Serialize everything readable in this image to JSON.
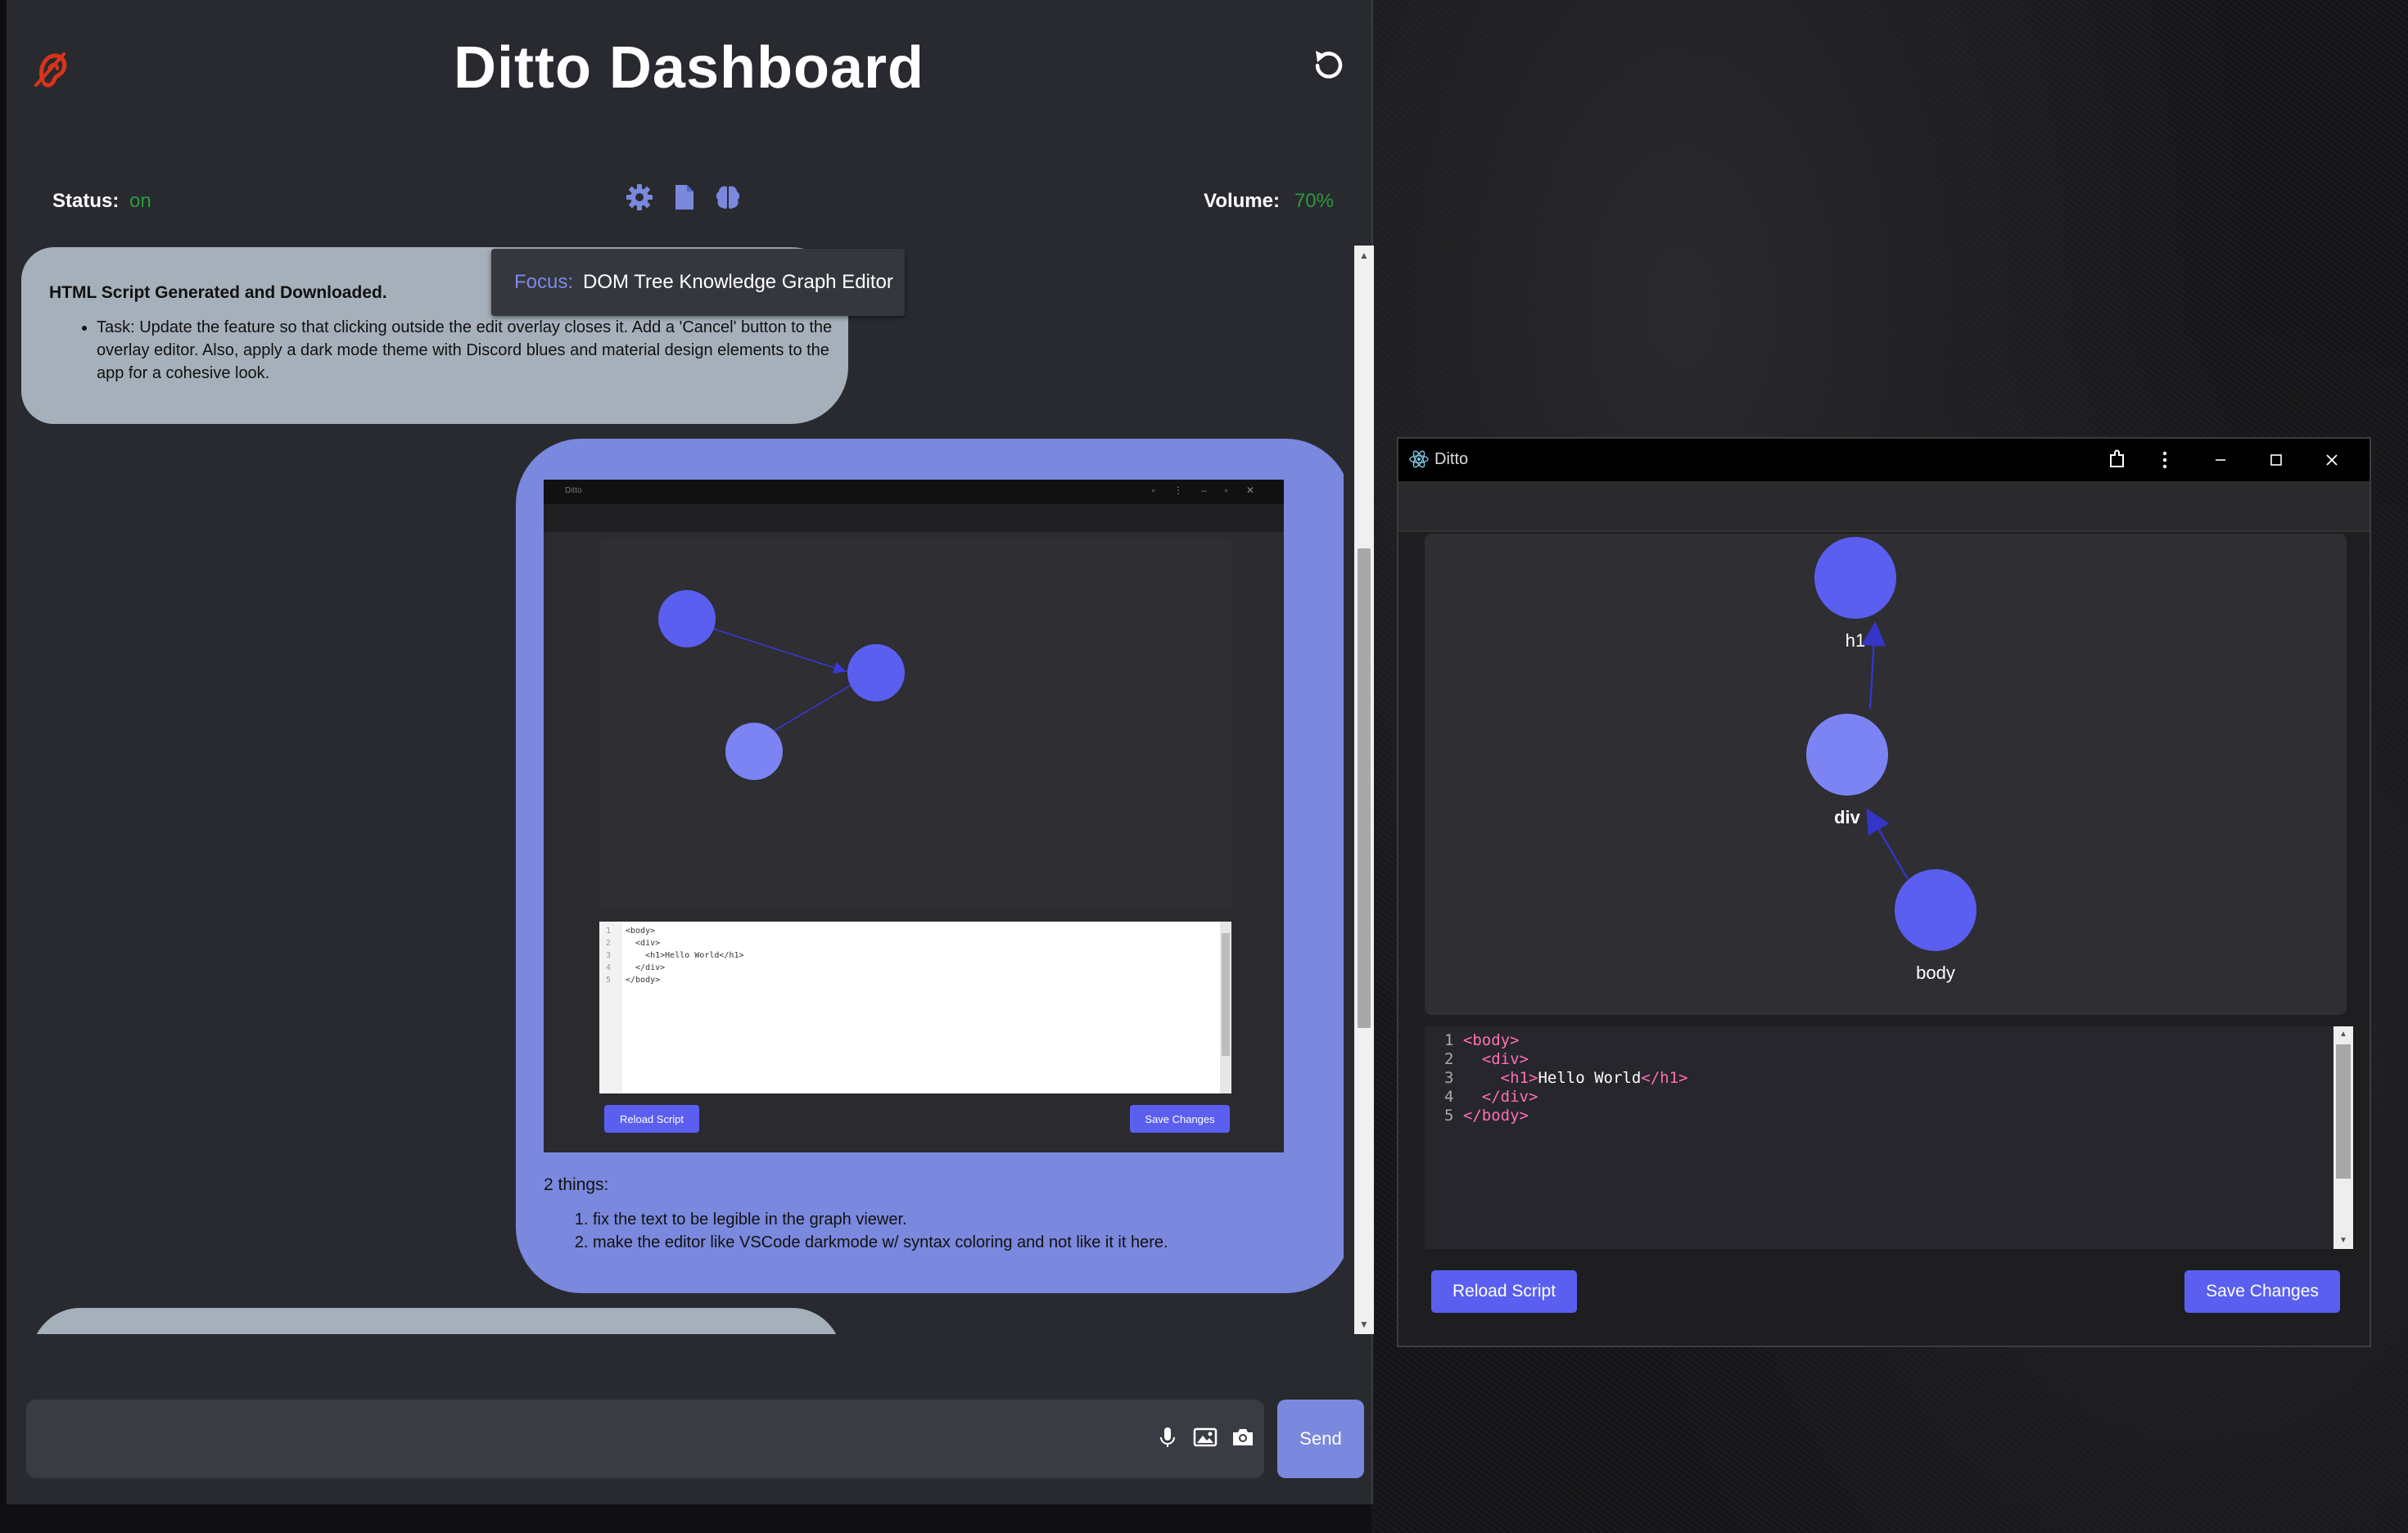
{
  "dashboard": {
    "title": "Ditto Dashboard",
    "status_label": "Status:",
    "status_value": "on",
    "volume_label": "Volume:",
    "volume_value": "70%",
    "focus_label": "Focus:",
    "focus_value": "DOM Tree Knowledge Graph Editor",
    "icons": [
      "ear-logo-icon",
      "refresh-icon",
      "gear-icon",
      "document-icon",
      "brain-icon"
    ],
    "colors": {
      "accent": "#7a88dd",
      "status": "#2f9a3a",
      "logo": "#d9341b"
    }
  },
  "messages": [
    {
      "heading": "HTML Script Generated and Downloaded.",
      "bullets": [
        "Task: Update the feature so that clicking outside the edit overlay closes it. Add a 'Cancel' button to the overlay editor. Also, apply a dark mode theme with Discord blues and material design elements to the app for a cohesive look."
      ]
    },
    {
      "screenshot": {
        "title": "Ditto",
        "code": "<body>\n  <div>\n    <h1>Hello World</h1>\n  </div>\n</body>",
        "line_numbers": "1\n2\n3\n4\n5",
        "reload_label": "Reload Script",
        "save_label": "Save Changes"
      },
      "intro": "2 things:",
      "items": [
        "fix the text to be legible in the graph viewer.",
        "make the editor like VSCode darkmode w/ syntax coloring and not like it it here."
      ]
    }
  ],
  "input": {
    "value": "",
    "send_label": "Send",
    "icons": [
      "microphone-icon",
      "image-icon",
      "camera-icon"
    ]
  },
  "ditto_window": {
    "title": "Ditto",
    "nodes": [
      "h1",
      "div",
      "body"
    ],
    "code_lines": [
      {
        "n": "1",
        "pre": "",
        "open": "<body>",
        "text": "",
        "close": ""
      },
      {
        "n": "2",
        "pre": "  ",
        "open": "<div>",
        "text": "",
        "close": ""
      },
      {
        "n": "3",
        "pre": "    ",
        "open": "<h1>",
        "text": "Hello World",
        "close": "</h1>"
      },
      {
        "n": "4",
        "pre": "  ",
        "open": "</div>",
        "text": "",
        "close": ""
      },
      {
        "n": "5",
        "pre": "",
        "open": "</body>",
        "text": "",
        "close": ""
      }
    ],
    "reload_label": "Reload Script",
    "save_label": "Save Changes",
    "node_color": "#5a5ff0",
    "node_highlight": "#7c84f4"
  }
}
